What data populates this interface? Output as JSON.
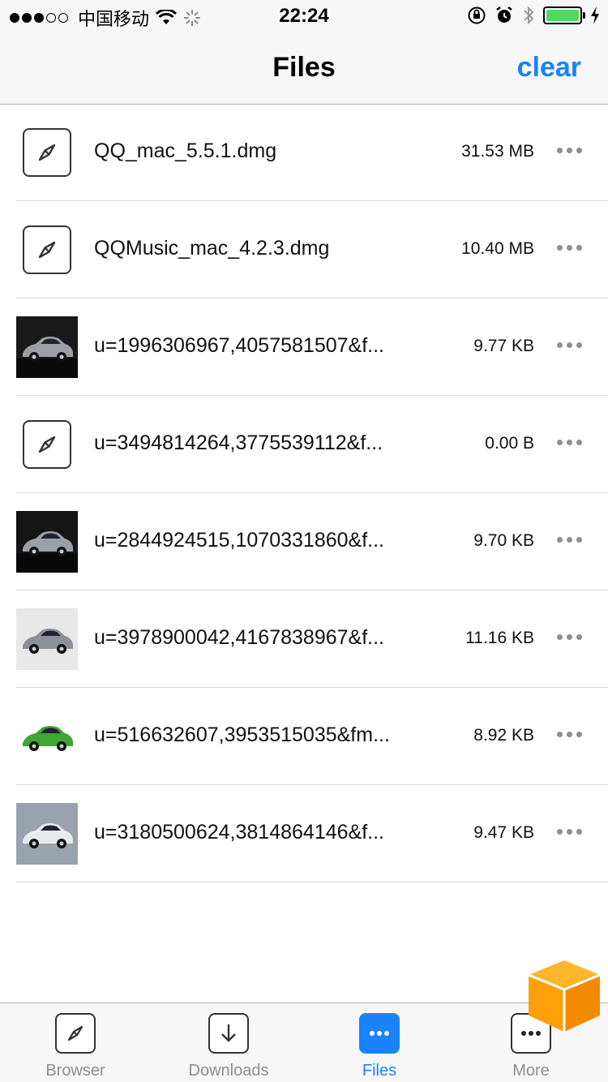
{
  "status_bar": {
    "carrier": "中国移动",
    "time": "22:24"
  },
  "navbar": {
    "title": "Files",
    "clear_label": "clear"
  },
  "files": [
    {
      "name": "QQ_mac_5.5.1.dmg",
      "size": "31.53 MB",
      "thumb": "safari",
      "icon": "compass-icon"
    },
    {
      "name": "QQMusic_mac_4.2.3.dmg",
      "size": "10.40 MB",
      "thumb": "safari",
      "icon": "compass-icon"
    },
    {
      "name": "u=1996306967,4057581507&f...",
      "size": "9.77 KB",
      "thumb": "dark-car",
      "color": "#1a1a1a"
    },
    {
      "name": "u=3494814264,3775539112&f...",
      "size": "0.00 B",
      "thumb": "safari",
      "icon": "compass-icon"
    },
    {
      "name": "u=2844924515,1070331860&f...",
      "size": "9.70 KB",
      "thumb": "dark-car",
      "color": "#151515"
    },
    {
      "name": "u=3978900042,4167838967&f...",
      "size": "11.16 KB",
      "thumb": "silver-car",
      "color": "#e8e8e8"
    },
    {
      "name": "u=516632607,3953515035&fm...",
      "size": "8.92 KB",
      "thumb": "green-car",
      "color": "#ffffff"
    },
    {
      "name": "u=3180500624,3814864146&f...",
      "size": "9.47 KB",
      "thumb": "suv-car",
      "color": "#9aa3ad"
    }
  ],
  "tabbar": {
    "tabs": [
      {
        "label": "Browser",
        "icon": "compass-icon",
        "active": false
      },
      {
        "label": "Downloads",
        "icon": "download-icon",
        "active": false
      },
      {
        "label": "Files",
        "icon": "ellipsis-icon",
        "active": true
      },
      {
        "label": "More",
        "icon": "ellipsis-icon",
        "active": false
      }
    ]
  },
  "colors": {
    "accent": "#1a82fb",
    "battery": "#4cd964",
    "float_box": "#ff9f0a"
  }
}
